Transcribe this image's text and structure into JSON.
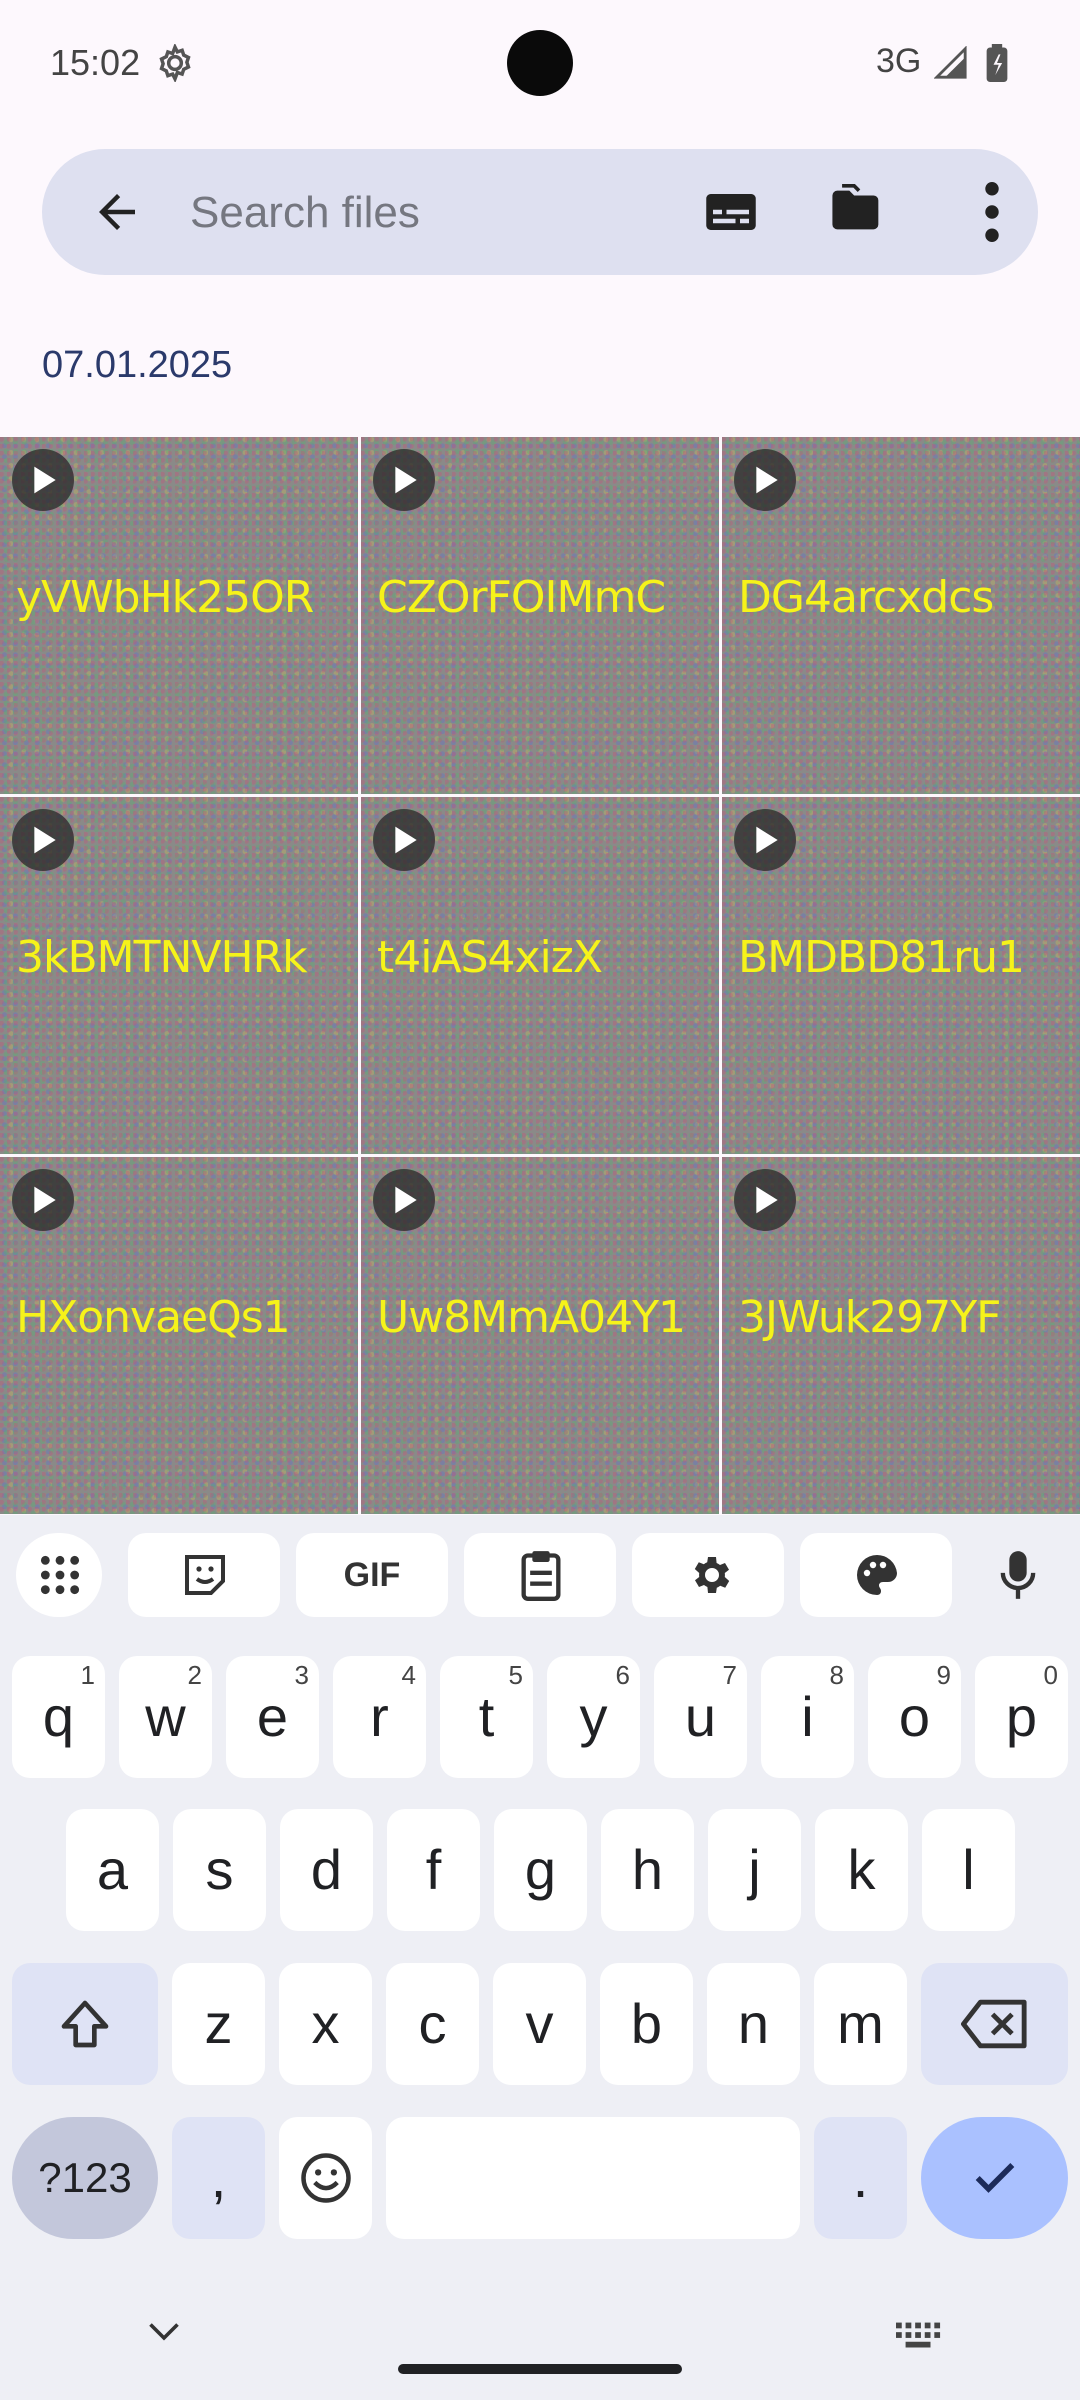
{
  "status_bar": {
    "time": "15:02",
    "network": "3G"
  },
  "search": {
    "placeholder": "Search files"
  },
  "date_header": "07.01.2025",
  "files": [
    {
      "name": "yVWbHk25OR"
    },
    {
      "name": "CZOrFOIMmC"
    },
    {
      "name": "DG4arcxdcs"
    },
    {
      "name": "3kBMTNVHRk"
    },
    {
      "name": "t4iAS4xizX"
    },
    {
      "name": "BMDBD81ru1"
    },
    {
      "name": "HXonvaeQs1"
    },
    {
      "name": "Uw8MmA04Y1"
    },
    {
      "name": "3JWuk297YF"
    }
  ],
  "keyboard": {
    "toolbar": {
      "gif": "GIF"
    },
    "row1": [
      {
        "key": "q",
        "num": "1"
      },
      {
        "key": "w",
        "num": "2"
      },
      {
        "key": "e",
        "num": "3"
      },
      {
        "key": "r",
        "num": "4"
      },
      {
        "key": "t",
        "num": "5"
      },
      {
        "key": "y",
        "num": "6"
      },
      {
        "key": "u",
        "num": "7"
      },
      {
        "key": "i",
        "num": "8"
      },
      {
        "key": "o",
        "num": "9"
      },
      {
        "key": "p",
        "num": "0"
      }
    ],
    "row2": [
      "a",
      "s",
      "d",
      "f",
      "g",
      "h",
      "j",
      "k",
      "l"
    ],
    "row3": [
      "z",
      "x",
      "c",
      "v",
      "b",
      "n",
      "m"
    ],
    "symbols": "?123",
    "comma": ",",
    "period": "."
  },
  "colors": {
    "accent": "#aac1ff",
    "search_bg": "#dee0f0",
    "file_label": "#f6f31a"
  }
}
